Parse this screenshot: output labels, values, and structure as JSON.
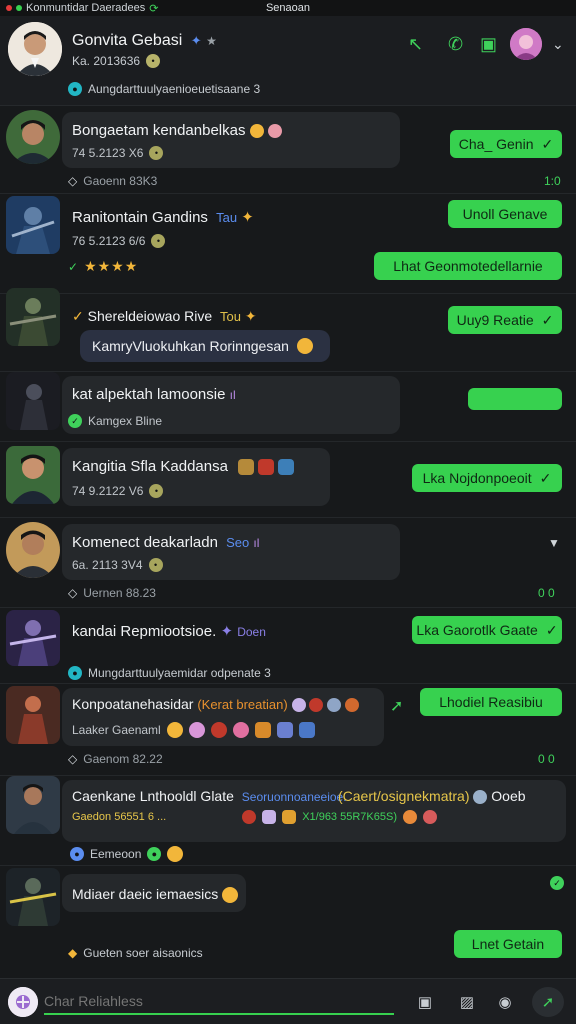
{
  "status_bar": {
    "left_text": "Konmuntidar Daeradees",
    "title": "Senaoan"
  },
  "header": {
    "name": "Gonvita Gebasi",
    "meta": "Ka. 2013636",
    "status": "Aungdarttuulyaenioeuetisaane 3"
  },
  "rows": [
    {
      "name": "Bongaetam kendanbelkas",
      "meta": "74 5.2123 X6",
      "button": "Cha_ Genin",
      "sub": "Gaoenn 83K3",
      "corner": "1:0"
    },
    {
      "name": "Ranitontain Gandins",
      "name_suffix": "Tau",
      "meta": "76 5.2123 6/6",
      "button": "Unoll Genave",
      "rating": "★★★★",
      "button2": "Lhat Geonmotedellarnie"
    },
    {
      "name": "Shereldeiowao Rive",
      "name_suffix": "Tou",
      "button": "Uuy9 Reatie",
      "pill": "KamryVluokuhkan Rorinngesan"
    },
    {
      "name": "kat alpektah lamoonsie",
      "sub_in_card": "Kamgex Bline"
    },
    {
      "name": "Kangitia Sfla Kaddansa",
      "meta": "74 9.2122 V6",
      "button": "Lka Nojdonpoeoit"
    },
    {
      "name": "Komenect deakarladn",
      "name_suffix": "Seo",
      "meta": "6a. 2113 3V4",
      "sub": "Uernen 88.23",
      "corner": "0 0"
    },
    {
      "name": "kandai Repmiootsioe.",
      "name_suffix": "Doen",
      "button": "Lka Gaorotlk Gaate",
      "sub": "Mungdarttuulyaemidar odpenate 3"
    },
    {
      "name": "Konpoatanehasidar",
      "name_suffix": "(Kerat breatian)",
      "sub_in_card": "Laaker Gaenaml",
      "button": "Lhodiel Reasibiu",
      "sub": "Gaenom 82.22",
      "corner": "0 0"
    },
    {
      "name": "Caenkane Lnthooldl Glate",
      "name_suffix": "Seoruonnoaneeioe.",
      "name_extra": "(Caert/osignekmatra)",
      "name_tail": "Ooeb",
      "line2": "Gaedon 56551 6 ...",
      "line3": "X1/963 55R7K65S)",
      "sub": "Eemeoon"
    },
    {
      "name": "Mdiaer daeic iemaesics"
    },
    {
      "sub": "Gueten soer aisaonics",
      "button": "Lnet Getain"
    }
  ],
  "input": {
    "placeholder": "Char Reliahless"
  }
}
